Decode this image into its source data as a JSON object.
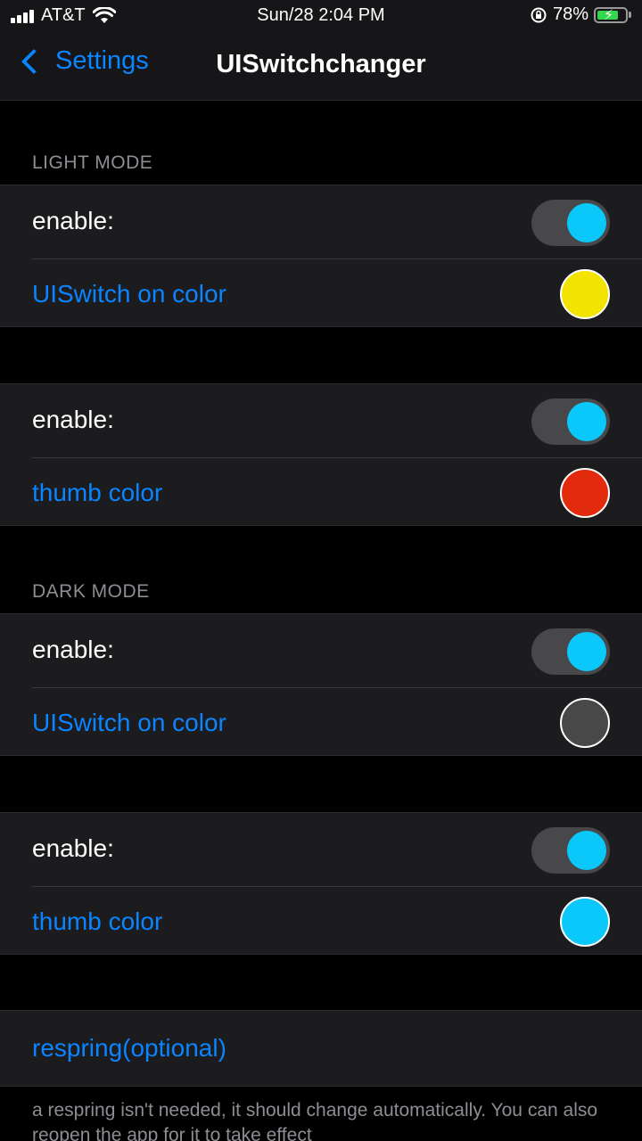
{
  "status_bar": {
    "carrier": "AT&T",
    "time": "Sun/28 2:04 PM",
    "battery_percent": "78%",
    "battery_level": 0.78
  },
  "nav": {
    "back_label": "Settings",
    "title": "UISwitchchanger"
  },
  "sections": {
    "light_mode": "LIGHT MODE",
    "dark_mode": "DARK MODE"
  },
  "groups": [
    {
      "toggle_label": "enable:",
      "toggle_on": true,
      "toggle_knob_color": "#0ac8f9",
      "color_label": "UISwitch on color",
      "swatch_color": "#f2e300"
    },
    {
      "toggle_label": "enable:",
      "toggle_on": true,
      "toggle_knob_color": "#0ac8f9",
      "color_label": "thumb color",
      "swatch_color": "#e42a0c"
    },
    {
      "toggle_label": "enable:",
      "toggle_on": true,
      "toggle_knob_color": "#0ac8f9",
      "color_label": "UISwitch on color",
      "swatch_color": "#484848"
    },
    {
      "toggle_label": "enable:",
      "toggle_on": true,
      "toggle_knob_color": "#0ac8f9",
      "color_label": "thumb color",
      "swatch_color": "#0ac8f9"
    }
  ],
  "respring": {
    "label": "respring(optional)",
    "footer": "a respring isn't needed, it should change automatically. You can also reopen the app for it to take effect"
  },
  "colors": {
    "accent": "#0a84ff",
    "cell_background": "#1c1c1e"
  }
}
